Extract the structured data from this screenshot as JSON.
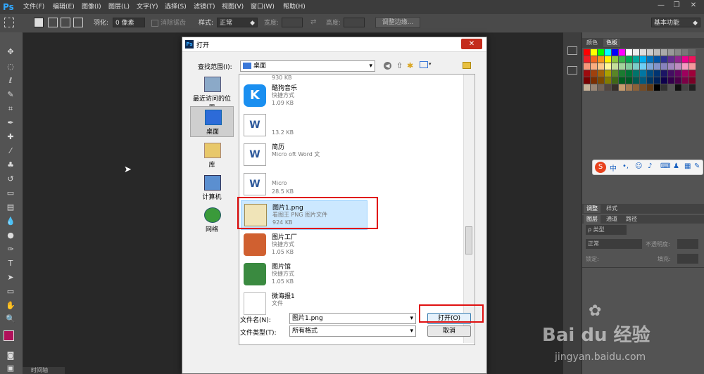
{
  "app": {
    "logo": "Ps"
  },
  "menu": [
    "文件(F)",
    "编辑(E)",
    "图像(I)",
    "图层(L)",
    "文字(Y)",
    "选择(S)",
    "滤镜(T)",
    "视图(V)",
    "窗口(W)",
    "帮助(H)"
  ],
  "options": {
    "feather_label": "羽化:",
    "feather_value": "0 像素",
    "antialias_label": "消除锯齿",
    "style_label": "样式:",
    "style_value": "正常",
    "width_label": "宽度:",
    "height_label": "高度:",
    "refine_edge": "调整边缘...",
    "workspace": "基本功能"
  },
  "panels": {
    "color_tab": "颜色",
    "swatches_tab": "色板",
    "adjust_tab": "调整",
    "styles_tab": "样式",
    "layers_tab": "图层",
    "channels_tab": "通道",
    "paths_tab": "路径",
    "kind_label": "类型",
    "blend_mode": "正常",
    "opacity_label": "不透明度:",
    "lock_label": "锁定:",
    "fill_label": "填充:",
    "ime_text": "中"
  },
  "timeline": "时间轴",
  "dialog": {
    "title": "打开",
    "look_in_label": "查找范围(I):",
    "look_in_value": "桌面",
    "places": [
      "最近访问的位置",
      "桌面",
      "库",
      "计算机",
      "网络"
    ],
    "files": [
      {
        "name": "",
        "type": "",
        "size": "930 KB"
      },
      {
        "name": "酷狗音乐",
        "type": "快捷方式",
        "size": "1.09 KB"
      },
      {
        "name": "　",
        "type": "",
        "size": "13.2 KB"
      },
      {
        "name": "简历",
        "type": "Micro     oft Word 文",
        "size": ""
      },
      {
        "name": "",
        "type": "Micro",
        "size": "28.5 KB"
      },
      {
        "name": "图片1.png",
        "type": "看图王 PNG 图片文件",
        "size": "924 KB"
      },
      {
        "name": "图片工厂",
        "type": "快捷方式",
        "size": "1.05 KB"
      },
      {
        "name": "图片馆",
        "type": "快捷方式",
        "size": "1.05 KB"
      },
      {
        "name": "微海报1",
        "type": "文件",
        "size": ""
      }
    ],
    "filename_label": "文件名(N):",
    "filename_value": "图片1.png",
    "filetype_label": "文件类型(T):",
    "filetype_value": "所有格式",
    "open_button": "打开(O)",
    "cancel_button": "取消"
  },
  "watermark": {
    "brand": "Bai du 经验",
    "url": "jingyan.baidu.com"
  }
}
